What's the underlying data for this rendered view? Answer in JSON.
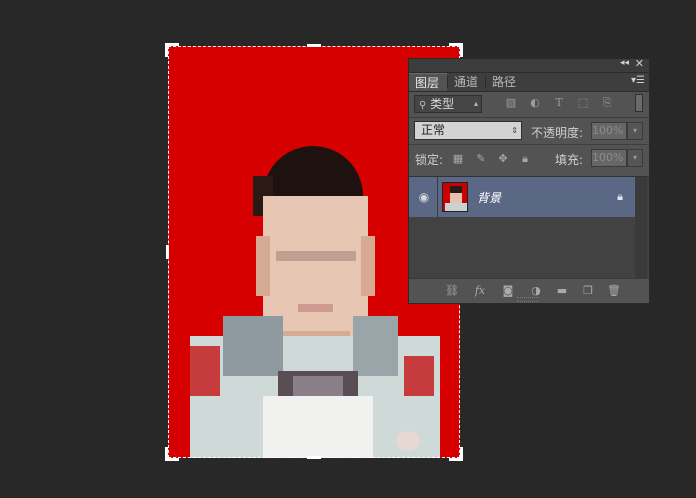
{
  "layers_panel": {
    "collapse_icon": "double-chevron-left-icon",
    "close_icon": "close-icon",
    "tabs": [
      {
        "label": "图层",
        "active": true
      },
      {
        "label": "通道",
        "active": false
      },
      {
        "label": "路径",
        "active": false
      }
    ],
    "panel_menu_icon": "panel-menu-icon",
    "filter": {
      "search_icon": "search-icon",
      "kind_value": "类型",
      "filter_icons": [
        "pixel-filter-icon",
        "adjustment-filter-icon",
        "type-filter-icon",
        "shape-filter-icon",
        "smart-object-filter-icon"
      ]
    },
    "blend_mode": "正常",
    "opacity": {
      "label": "不透明度:",
      "value": "100%"
    },
    "lock": {
      "label": "锁定:",
      "icons": [
        "lock-transparent-pixels-icon",
        "lock-image-pixels-icon",
        "lock-position-icon",
        "lock-all-icon"
      ]
    },
    "fill": {
      "label": "填充:",
      "value": "100%"
    },
    "layers": [
      {
        "name": "背景",
        "visible": true,
        "locked": true,
        "selected": true
      }
    ],
    "bottom_icons": [
      "link-layers-icon",
      "fx-icon",
      "layer-mask-icon",
      "adjustment-layer-icon",
      "group-folder-icon",
      "new-layer-icon",
      "trash-icon"
    ]
  },
  "colors": {
    "workspace_bg": "#282828",
    "photo_bg_red": "#d60000",
    "panel_bg": "#535353",
    "selected_layer": "#5a6886"
  }
}
